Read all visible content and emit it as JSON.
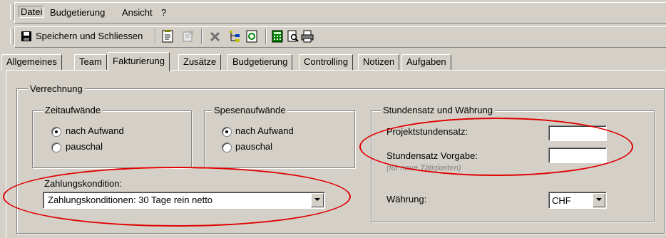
{
  "menubar": {
    "items": [
      "Datei",
      "Budgetierung",
      "Ansicht",
      "?"
    ]
  },
  "toolbar": {
    "save_label": "Speichern und Schliessen"
  },
  "tabs": [
    "Allgemeines",
    "Team",
    "Fakturierung",
    "Zusätze",
    "Budgetierung",
    "Controlling",
    "Notizen",
    "Aufgaben"
  ],
  "verrechnung": {
    "legend": "Verrechnung",
    "zeit": {
      "legend": "Zeitaufwände",
      "opt1": "nach Aufwand",
      "opt2": "pauschal"
    },
    "spesen": {
      "legend": "Spesenaufwände",
      "opt1": "nach Aufwand",
      "opt2": "pauschal"
    },
    "zahlung": {
      "label": "Zahlungskondition:",
      "value": "Zahlungskonditionen: 30 Tage rein netto"
    },
    "stunden": {
      "legend": "Stundensatz und Währung",
      "projekt_label": "Projektstundensatz:",
      "vorgabe_label": "Stundensatz Vorgabe:",
      "vorgabe_hint": "(für neue Tätigkeiten)",
      "waehrung_label": "Währung:",
      "waehrung_value": "CHF"
    }
  },
  "colors": {
    "annotation": "#e00000",
    "face": "#d4d0c8"
  }
}
